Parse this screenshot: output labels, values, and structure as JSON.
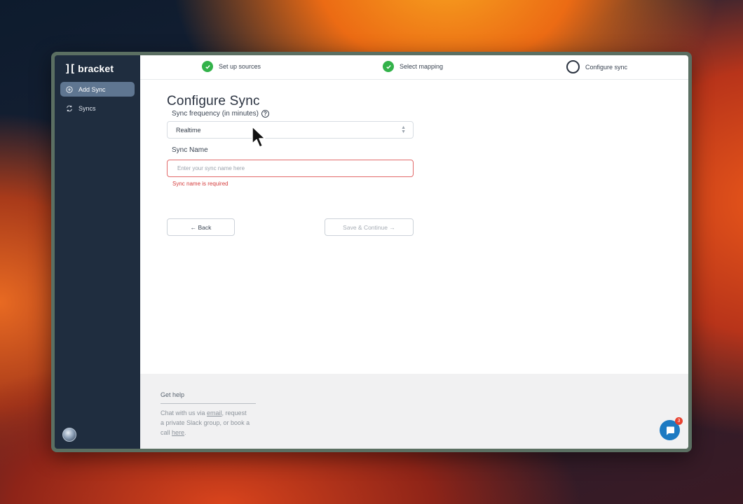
{
  "brand": {
    "logo_mark": "][",
    "name": "bracket"
  },
  "sidebar": {
    "items": [
      {
        "label": "Add Sync",
        "icon": "plus-circle-icon",
        "active": true
      },
      {
        "label": "Syncs",
        "icon": "refresh-icon",
        "active": false
      }
    ]
  },
  "stepper": {
    "steps": [
      {
        "label": "Set up sources",
        "status": "complete"
      },
      {
        "label": "Select mapping",
        "status": "complete"
      },
      {
        "label": "Configure sync",
        "status": "current"
      }
    ]
  },
  "form": {
    "title": "Configure Sync",
    "frequency_label": "Sync frequency (in minutes)",
    "frequency_value": "Realtime",
    "name_label": "Sync Name",
    "name_placeholder": "Enter your sync name here",
    "name_value": "",
    "name_error": "Sync name is required",
    "back_label": "← Back",
    "save_label": "Save & Continue →"
  },
  "footer": {
    "help_title": "Get help",
    "help_text_1": "Chat with us via ",
    "email_link": "email",
    "help_text_2": ", request a private Slack group, or book a call ",
    "here_link": "here",
    "help_text_3": "."
  },
  "chat": {
    "badge_count": "3"
  },
  "colors": {
    "sidebar_bg": "#1f2d3f",
    "active_nav": "#5f7691",
    "step_complete": "#33b24a",
    "error": "#d43c3c",
    "chat_button": "#1d7ac2"
  }
}
